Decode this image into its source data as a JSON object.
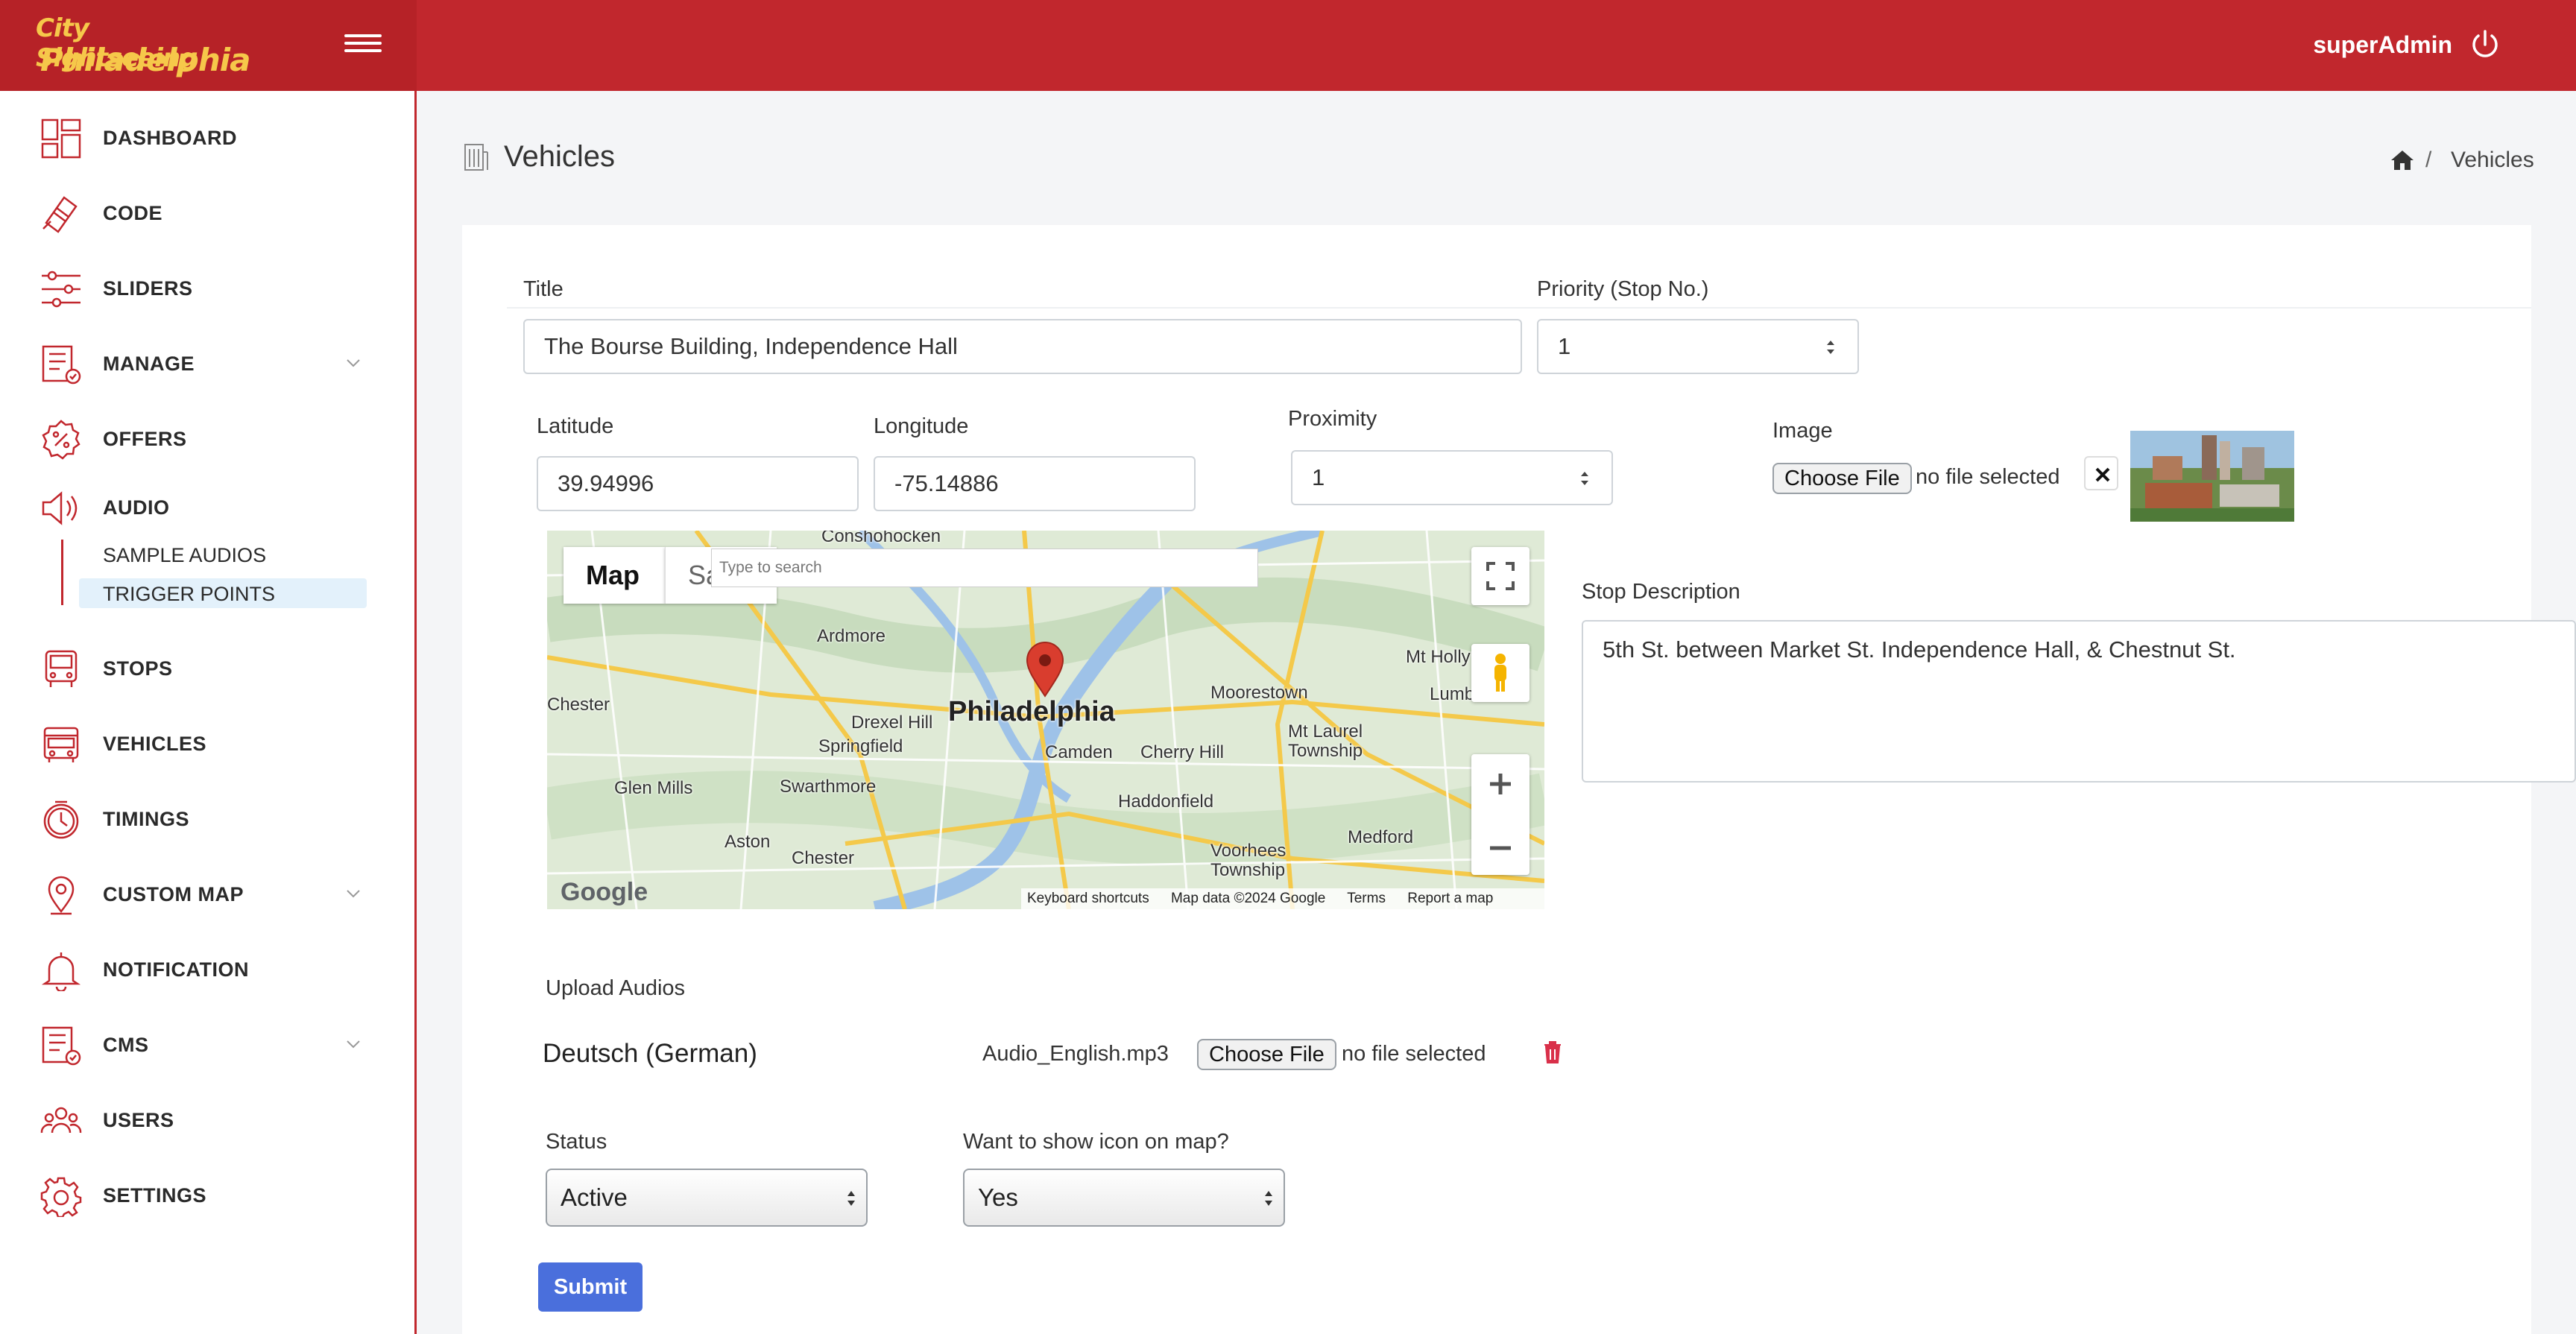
{
  "brand": {
    "line1": "City Sightseeing",
    "line2": "Philadelphia"
  },
  "header": {
    "user": "superAdmin"
  },
  "sidebar": {
    "items": [
      {
        "label": "DASHBOARD",
        "icon": "dashboard-icon"
      },
      {
        "label": "CODE",
        "icon": "ticket-icon"
      },
      {
        "label": "SLIDERS",
        "icon": "sliders-icon"
      },
      {
        "label": "MANAGE",
        "icon": "checklist-icon",
        "has_submenu": true
      },
      {
        "label": "OFFERS",
        "icon": "percent-badge-icon"
      },
      {
        "label": "AUDIO",
        "icon": "speaker-icon"
      },
      {
        "label": "STOPS",
        "icon": "bus-stop-icon"
      },
      {
        "label": "VEHICLES",
        "icon": "bus-icon"
      },
      {
        "label": "TIMINGS",
        "icon": "clock-icon"
      },
      {
        "label": "CUSTOM MAP",
        "icon": "map-pin-icon",
        "has_submenu": true
      },
      {
        "label": "NOTIFICATION",
        "icon": "bell-icon"
      },
      {
        "label": "CMS",
        "icon": "checklist-icon",
        "has_submenu": true
      },
      {
        "label": "USERS",
        "icon": "users-icon"
      },
      {
        "label": "SETTINGS",
        "icon": "gear-icon"
      }
    ],
    "audio_sub": [
      "SAMPLE AUDIOS",
      "TRIGGER POINTS"
    ]
  },
  "page": {
    "title": "Vehicles",
    "breadcrumb_current": "Vehicles",
    "breadcrumb_sep": "/"
  },
  "form": {
    "title_label": "Title",
    "title_value": "The Bourse Building, Independence Hall",
    "priority_label": "Priority (Stop No.)",
    "priority_value": "1",
    "latitude_label": "Latitude",
    "latitude_value": "39.94996",
    "longitude_label": "Longitude",
    "longitude_value": "-75.14886",
    "proximity_label": "Proximity",
    "proximity_value": "1",
    "image_label": "Image",
    "choose_file": "Choose File",
    "no_file": "no file selected",
    "stop_desc_label": "Stop Description",
    "stop_desc_value": "5th St. between Market St. Independence Hall, & Chestnut St.",
    "upload_audios_label": "Upload Audios",
    "audio_lang": "Deutsch (German)",
    "audio_file": "Audio_English.mp3",
    "status_label": "Status",
    "status_value": "Active",
    "show_icon_label": "Want to show icon on map?",
    "show_icon_value": "Yes",
    "submit": "Submit"
  },
  "map": {
    "tab_map": "Map",
    "tab_sat": "Sa",
    "search_placeholder": "Type to search",
    "footer": [
      "Keyboard shortcuts",
      "Map data ©2024 Google",
      "Terms",
      "Report a map error"
    ],
    "google": "Google",
    "cities": [
      {
        "name": "Conshohocken"
      },
      {
        "name": "Ardmore"
      },
      {
        "name": "Philadelphia",
        "major": true
      },
      {
        "name": "Drexel Hill"
      },
      {
        "name": "Springfield"
      },
      {
        "name": "Chester"
      },
      {
        "name": "Glen Mills"
      },
      {
        "name": "Swarthmore"
      },
      {
        "name": "Aston"
      },
      {
        "name": "Camden"
      },
      {
        "name": "Cherry Hill"
      },
      {
        "name": "Moorestown"
      },
      {
        "name": "Mt Holly"
      },
      {
        "name": "Lumberton"
      },
      {
        "name": "Mt Laurel"
      },
      {
        "name": "Township"
      },
      {
        "name": "Haddonfield"
      },
      {
        "name": "Voorhees"
      },
      {
        "name": "Township"
      },
      {
        "name": "Medford"
      },
      {
        "name": "Chester"
      }
    ]
  },
  "colors": {
    "brand_red": "#c1272d",
    "submit_blue": "#4a6fdc",
    "active_sub": "#e3f1fb"
  }
}
